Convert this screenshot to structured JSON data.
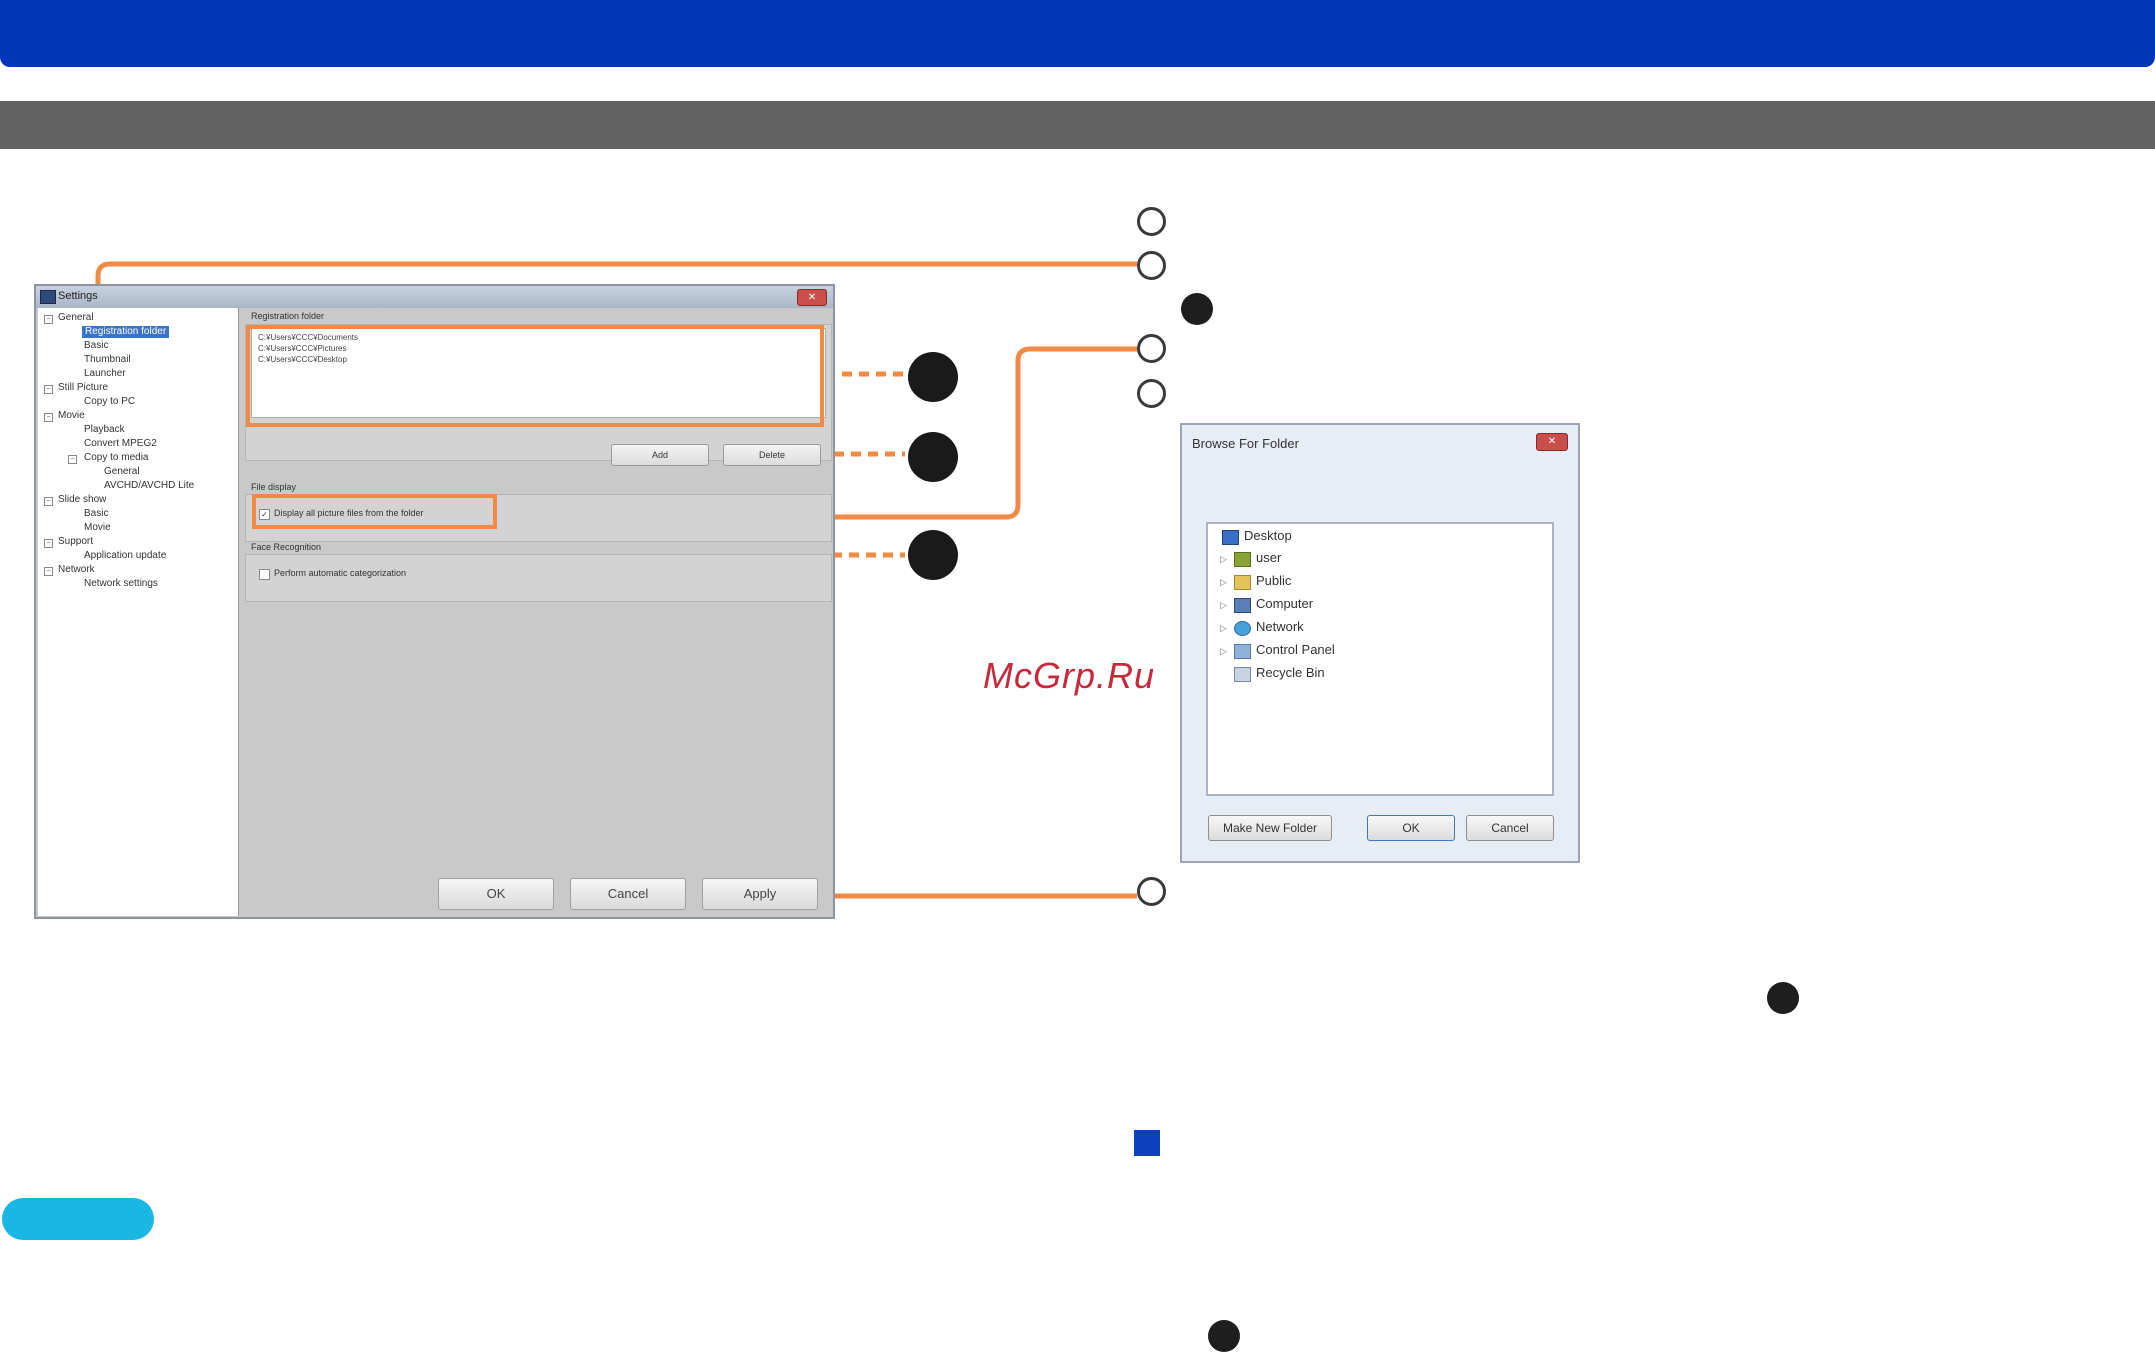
{
  "watermark": "McGrp.Ru",
  "settings_dialog": {
    "title": "Settings",
    "tree": [
      {
        "label": "General",
        "level": 0
      },
      {
        "label": "Registration folder",
        "level": 1,
        "selected": true
      },
      {
        "label": "Basic",
        "level": 1
      },
      {
        "label": "Thumbnail",
        "level": 1
      },
      {
        "label": "Launcher",
        "level": 1
      },
      {
        "label": "Still Picture",
        "level": 0
      },
      {
        "label": "Copy to PC",
        "level": 1
      },
      {
        "label": "Movie",
        "level": 0
      },
      {
        "label": "Playback",
        "level": 1
      },
      {
        "label": "Convert MPEG2",
        "level": 1
      },
      {
        "label": "Copy to media",
        "level": 1
      },
      {
        "label": "General",
        "level": 2
      },
      {
        "label": "AVCHD/AVCHD Lite",
        "level": 2
      },
      {
        "label": "Slide show",
        "level": 0
      },
      {
        "label": "Basic",
        "level": 1
      },
      {
        "label": "Movie",
        "level": 1
      },
      {
        "label": "Support",
        "level": 0
      },
      {
        "label": "Application update",
        "level": 1
      },
      {
        "label": "Network",
        "level": 0
      },
      {
        "label": "Network settings",
        "level": 1
      }
    ],
    "registration_folder_label": "Registration folder",
    "folders": [
      "C:¥Users¥CCC¥Documents",
      "C:¥Users¥CCC¥Pictures",
      "C:¥Users¥CCC¥Desktop"
    ],
    "add_label": "Add",
    "delete_label": "Delete",
    "file_display_label": "File display",
    "display_all_label": "Display all picture files from the folder",
    "face_recognition_label": "Face Recognition",
    "auto_categorization_label": "Perform automatic categorization",
    "ok_label": "OK",
    "cancel_label": "Cancel",
    "apply_label": "Apply"
  },
  "browse_dialog": {
    "title": "Browse For Folder",
    "items": [
      "Desktop",
      "user",
      "Public",
      "Computer",
      "Network",
      "Control Panel",
      "Recycle Bin"
    ],
    "make_new_folder_label": "Make New Folder",
    "ok_label": "OK",
    "cancel_label": "Cancel"
  },
  "colors": {
    "header_blue": "#0037b8",
    "section_gray": "#636262",
    "callout_orange": "#f08a45",
    "accent_cyan": "#1ab7e3"
  }
}
